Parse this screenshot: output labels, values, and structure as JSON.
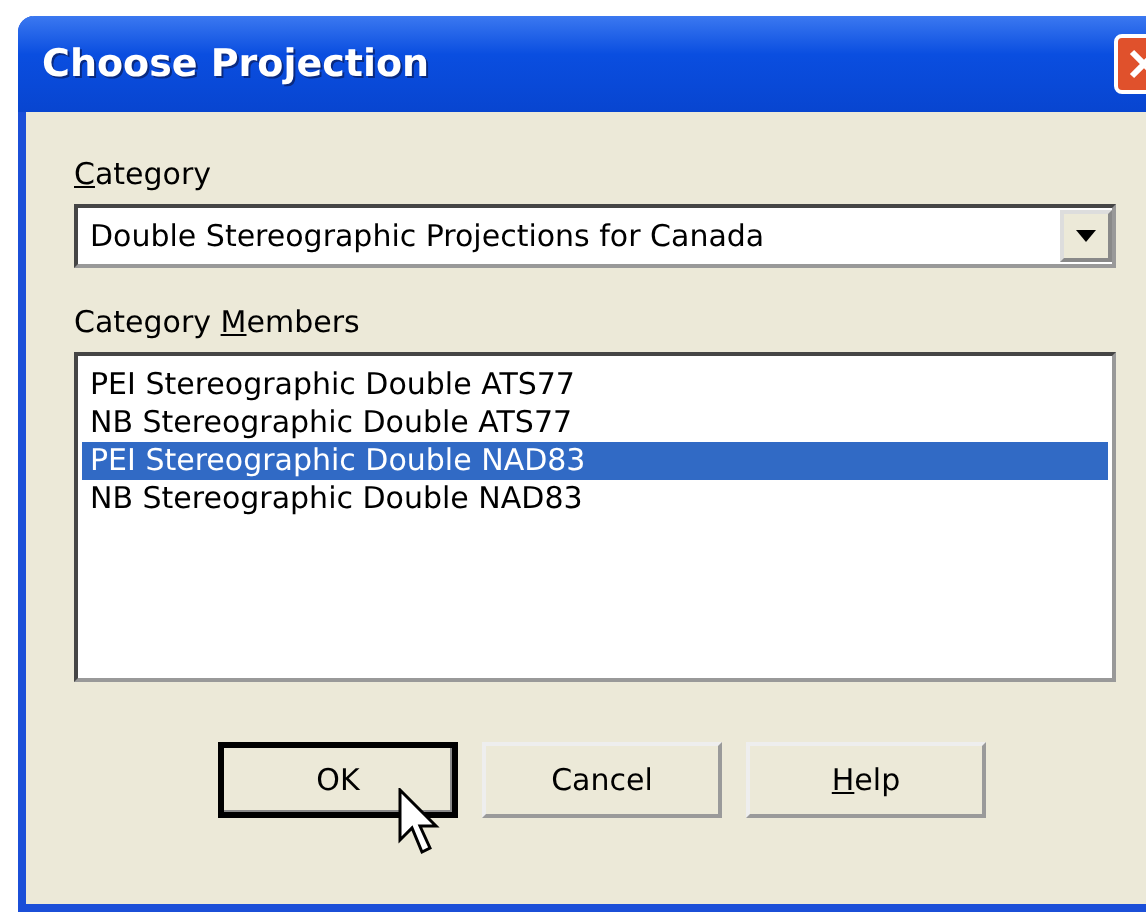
{
  "window": {
    "title": "Choose Projection"
  },
  "category": {
    "label": {
      "key": "C",
      "after": "ategory"
    },
    "value": "Double Stereographic Projections for Canada"
  },
  "members": {
    "label": {
      "before": "Category ",
      "key": "M",
      "after": "embers"
    },
    "items": [
      {
        "text": "PEI Stereographic Double ATS77",
        "selected": false
      },
      {
        "text": "NB Stereographic Double ATS77",
        "selected": false
      },
      {
        "text": "PEI Stereographic Double NAD83",
        "selected": true
      },
      {
        "text": "NB Stereographic Double NAD83",
        "selected": false
      }
    ]
  },
  "buttons": [
    {
      "label": {
        "before": "OK"
      },
      "default": true
    },
    {
      "label": {
        "before": "Cancel"
      },
      "default": false
    },
    {
      "label": {
        "key": "H",
        "after": "elp"
      },
      "default": false
    }
  ]
}
